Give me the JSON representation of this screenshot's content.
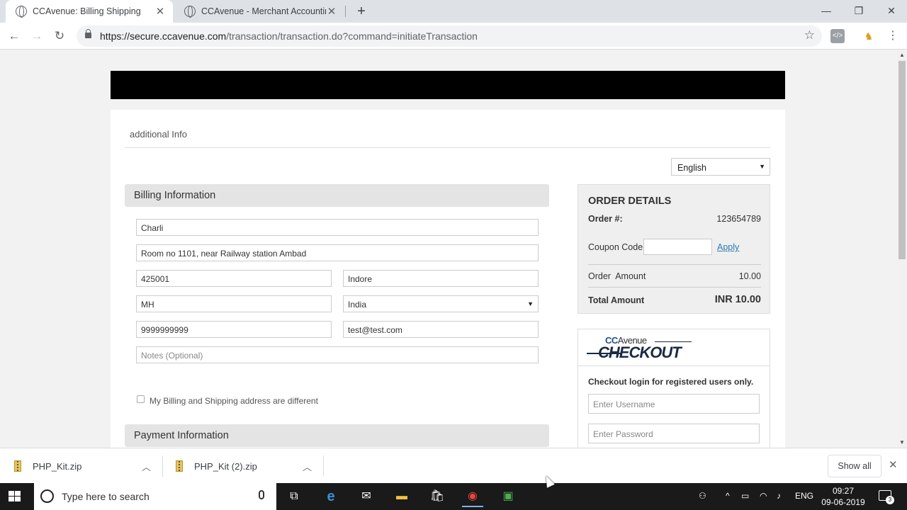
{
  "browser": {
    "tabs": [
      {
        "title": "CCAvenue: Billing Shipping",
        "icon": "globe-icon",
        "active": true
      },
      {
        "title": "CCAvenue - Merchant Accounting",
        "icon": "globe-icon",
        "active": false
      }
    ],
    "new_tab": "+",
    "window_controls": {
      "minimize": "—",
      "restore": "❐",
      "close": "✕"
    },
    "url_host": "https://secure.ccavenue.com",
    "url_path": "/transaction/transaction.do?command=initiateTransaction"
  },
  "page": {
    "additional_info": "additional Info",
    "language": "English",
    "billing": {
      "heading": "Billing Information",
      "name": "Charli",
      "address": "Room no 1101, near Railway station Ambad",
      "zip": "425001",
      "city": "Indore",
      "state": "MH",
      "country": "India",
      "phone": "9999999999",
      "email": "test@test.com",
      "notes_placeholder": "Notes (Optional)"
    },
    "shipping_checkbox_label": "My Billing and Shipping address are different",
    "payment_heading": "Payment Information",
    "order": {
      "title": "ORDER DETAILS",
      "order_label": "Order #:",
      "order_number": "123654789",
      "coupon_label": "Coupon Code",
      "apply_label": "Apply",
      "amount_label": "Order  Amount",
      "amount_value": "10.00",
      "total_label": "Total Amount",
      "total_value": "INR 10.00"
    },
    "checkout": {
      "logo_cc": "CC",
      "logo_avenue": "Avenue",
      "logo_checkout": "CHECKOUT",
      "login_text": "Checkout login for registered users only.",
      "username_placeholder": "Enter Username",
      "password_placeholder": "Enter Password"
    }
  },
  "downloads": {
    "items": [
      {
        "name": "PHP_Kit.zip"
      },
      {
        "name": "PHP_Kit (2).zip"
      }
    ],
    "show_all": "Show all"
  },
  "taskbar": {
    "search_text": "Type here to search",
    "language": "ENG",
    "time": "09:27",
    "date": "09-06-2019",
    "notification_count": "3"
  }
}
